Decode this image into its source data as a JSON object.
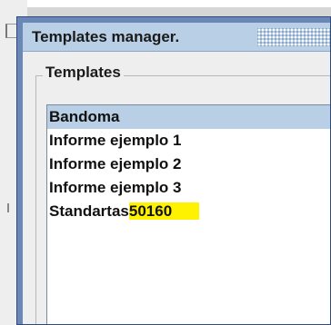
{
  "dialog": {
    "title": "Templates manager."
  },
  "templates_group": {
    "legend": "Templates",
    "items": [
      {
        "label": "Bandoma",
        "selected": true
      },
      {
        "label": "Informe ejemplo 1",
        "selected": false
      },
      {
        "label": "Informe ejemplo 2",
        "selected": false
      },
      {
        "label": "Informe ejemplo 3",
        "selected": false
      },
      {
        "label": "Standartas",
        "highlight": "50160",
        "selected": false
      }
    ]
  },
  "colors": {
    "titlebar": "#b8cfe6",
    "window_frame": "#6a87b8",
    "selection": "#b8cfe5",
    "highlight": "#fff200"
  }
}
